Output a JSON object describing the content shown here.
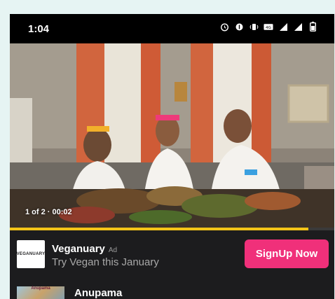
{
  "status_bar": {
    "time": "1:04",
    "icons": [
      "alarm-icon",
      "data-saver-icon",
      "vibrate-icon",
      "volte-icon",
      "signal-icon",
      "signal-icon-2",
      "battery-icon"
    ]
  },
  "video": {
    "counter": "1 of 2 · 00:02",
    "progress": 0.92,
    "accent_color": "#f5c518"
  },
  "ad": {
    "logo_text": "VEGANUARY",
    "title": "Veganuary",
    "badge": "Ad",
    "subtitle": "Try Vegan this January",
    "cta_label": "SignUp Now",
    "cta_color": "#f0307a"
  },
  "next_item": {
    "thumb_text": "Anupama",
    "title": "Anupama"
  }
}
